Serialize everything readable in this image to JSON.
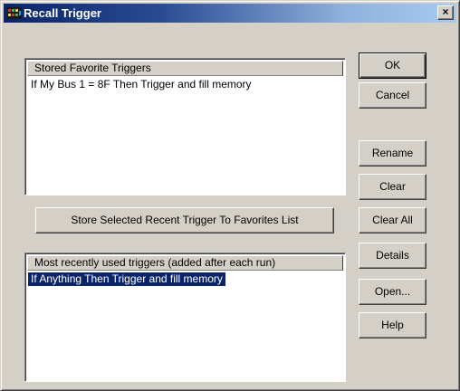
{
  "window": {
    "title": "Recall Trigger"
  },
  "icons": {
    "app": "app-icon",
    "close": "close-icon"
  },
  "titlebar": {
    "close_label": "×"
  },
  "favorites": {
    "header": "Stored Favorite Triggers",
    "items": [
      "If My Bus 1 = 8F Then Trigger and fill memory"
    ]
  },
  "recent": {
    "header": "Most recently used triggers (added after each run)",
    "items": [
      {
        "label": "If Anything Then Trigger and fill memory",
        "selected": true
      }
    ]
  },
  "buttons": {
    "store": "Store Selected Recent Trigger To Favorites List",
    "ok": "OK",
    "cancel": "Cancel",
    "rename": "Rename",
    "clear": "Clear",
    "clear_all": "Clear All",
    "details": "Details",
    "open": "Open...",
    "help": "Help"
  },
  "colors": {
    "titlebar_start": "#0a246a",
    "titlebar_end": "#a6caf0",
    "selection": "#0a246a",
    "face": "#d4d0c8"
  }
}
